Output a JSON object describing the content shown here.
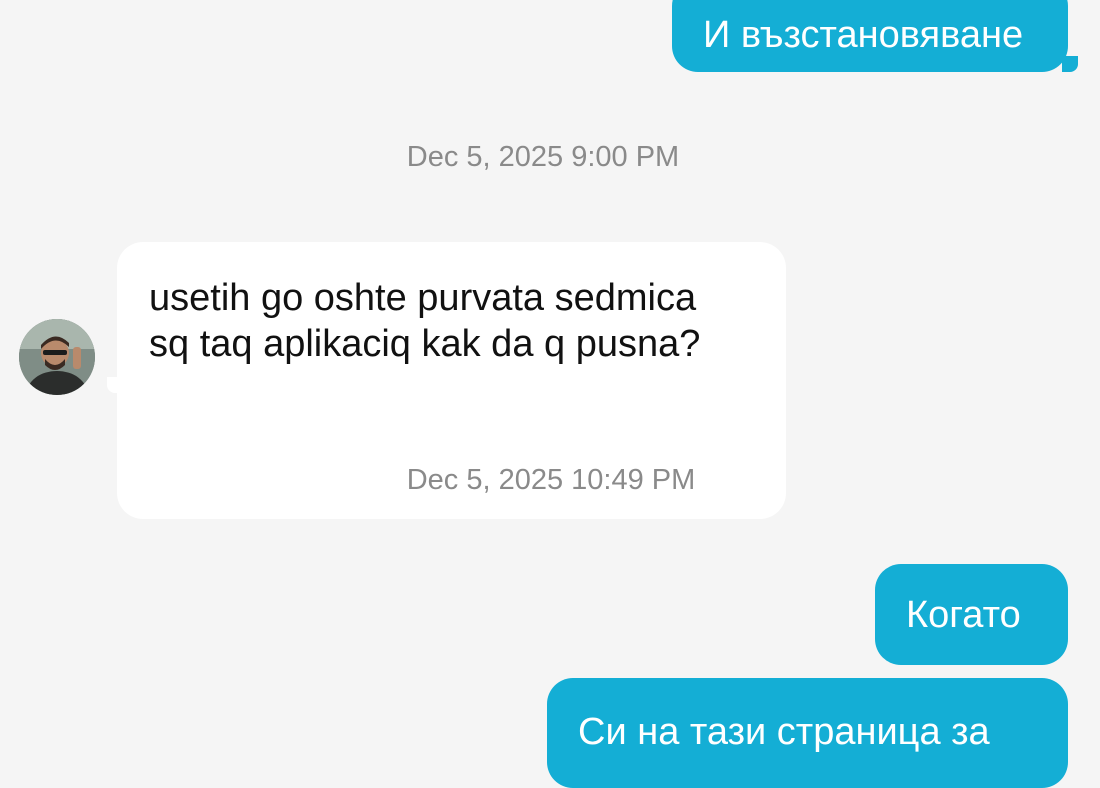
{
  "chat": {
    "messages": [
      {
        "direction": "outgoing",
        "text": "И възстановяване"
      },
      {
        "timestamp": "Dec 5, 2025 9:00 PM"
      },
      {
        "direction": "incoming",
        "lines": [
          "usetih go oshte purvata sedmica",
          "sq taq aplikaciq kak da q pusna?"
        ]
      },
      {
        "timestamp": "Dec 5, 2025 10:49 PM"
      },
      {
        "direction": "outgoing",
        "text": "Когато"
      },
      {
        "direction": "outgoing",
        "text": "Си на тази страница за"
      }
    ]
  },
  "colors": {
    "background": "#f5f5f5",
    "outgoing_bubble": "#14aed5",
    "incoming_bubble": "#ffffff",
    "timestamp_text": "#8a8a8a"
  },
  "icons": {
    "contact_avatar": "avatar-photo"
  }
}
